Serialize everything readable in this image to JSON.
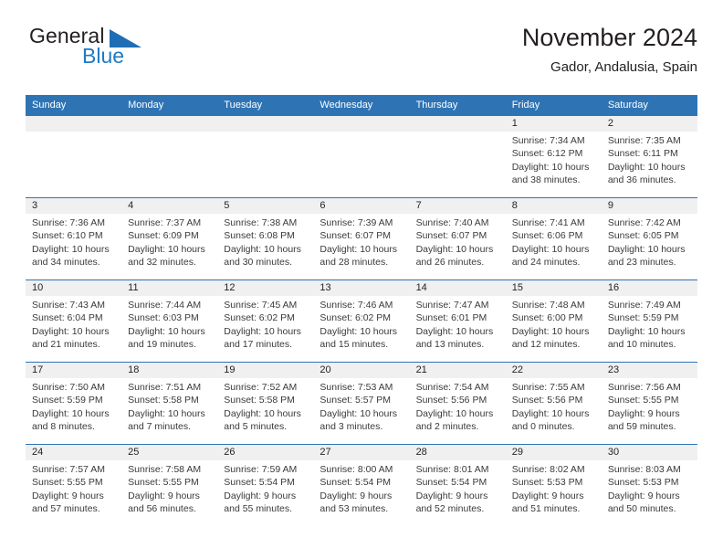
{
  "brand": {
    "name_top": "General",
    "name_bottom": "Blue",
    "triangle_color": "#1f6eb5",
    "blue_color": "#1f7ac4"
  },
  "header": {
    "title": "November 2024",
    "subtitle": "Gador, Andalusia, Spain"
  },
  "theme": {
    "header_blue": "#2e74b5",
    "day_band_gray": "#f0f0f0",
    "text_color": "#231f20"
  },
  "weekdays": [
    "Sunday",
    "Monday",
    "Tuesday",
    "Wednesday",
    "Thursday",
    "Friday",
    "Saturday"
  ],
  "weeks": [
    [
      {
        "day": "",
        "sunrise": "",
        "sunset": "",
        "daylight1": "",
        "daylight2": ""
      },
      {
        "day": "",
        "sunrise": "",
        "sunset": "",
        "daylight1": "",
        "daylight2": ""
      },
      {
        "day": "",
        "sunrise": "",
        "sunset": "",
        "daylight1": "",
        "daylight2": ""
      },
      {
        "day": "",
        "sunrise": "",
        "sunset": "",
        "daylight1": "",
        "daylight2": ""
      },
      {
        "day": "",
        "sunrise": "",
        "sunset": "",
        "daylight1": "",
        "daylight2": ""
      },
      {
        "day": "1",
        "sunrise": "Sunrise: 7:34 AM",
        "sunset": "Sunset: 6:12 PM",
        "daylight1": "Daylight: 10 hours",
        "daylight2": "and 38 minutes."
      },
      {
        "day": "2",
        "sunrise": "Sunrise: 7:35 AM",
        "sunset": "Sunset: 6:11 PM",
        "daylight1": "Daylight: 10 hours",
        "daylight2": "and 36 minutes."
      }
    ],
    [
      {
        "day": "3",
        "sunrise": "Sunrise: 7:36 AM",
        "sunset": "Sunset: 6:10 PM",
        "daylight1": "Daylight: 10 hours",
        "daylight2": "and 34 minutes."
      },
      {
        "day": "4",
        "sunrise": "Sunrise: 7:37 AM",
        "sunset": "Sunset: 6:09 PM",
        "daylight1": "Daylight: 10 hours",
        "daylight2": "and 32 minutes."
      },
      {
        "day": "5",
        "sunrise": "Sunrise: 7:38 AM",
        "sunset": "Sunset: 6:08 PM",
        "daylight1": "Daylight: 10 hours",
        "daylight2": "and 30 minutes."
      },
      {
        "day": "6",
        "sunrise": "Sunrise: 7:39 AM",
        "sunset": "Sunset: 6:07 PM",
        "daylight1": "Daylight: 10 hours",
        "daylight2": "and 28 minutes."
      },
      {
        "day": "7",
        "sunrise": "Sunrise: 7:40 AM",
        "sunset": "Sunset: 6:07 PM",
        "daylight1": "Daylight: 10 hours",
        "daylight2": "and 26 minutes."
      },
      {
        "day": "8",
        "sunrise": "Sunrise: 7:41 AM",
        "sunset": "Sunset: 6:06 PM",
        "daylight1": "Daylight: 10 hours",
        "daylight2": "and 24 minutes."
      },
      {
        "day": "9",
        "sunrise": "Sunrise: 7:42 AM",
        "sunset": "Sunset: 6:05 PM",
        "daylight1": "Daylight: 10 hours",
        "daylight2": "and 23 minutes."
      }
    ],
    [
      {
        "day": "10",
        "sunrise": "Sunrise: 7:43 AM",
        "sunset": "Sunset: 6:04 PM",
        "daylight1": "Daylight: 10 hours",
        "daylight2": "and 21 minutes."
      },
      {
        "day": "11",
        "sunrise": "Sunrise: 7:44 AM",
        "sunset": "Sunset: 6:03 PM",
        "daylight1": "Daylight: 10 hours",
        "daylight2": "and 19 minutes."
      },
      {
        "day": "12",
        "sunrise": "Sunrise: 7:45 AM",
        "sunset": "Sunset: 6:02 PM",
        "daylight1": "Daylight: 10 hours",
        "daylight2": "and 17 minutes."
      },
      {
        "day": "13",
        "sunrise": "Sunrise: 7:46 AM",
        "sunset": "Sunset: 6:02 PM",
        "daylight1": "Daylight: 10 hours",
        "daylight2": "and 15 minutes."
      },
      {
        "day": "14",
        "sunrise": "Sunrise: 7:47 AM",
        "sunset": "Sunset: 6:01 PM",
        "daylight1": "Daylight: 10 hours",
        "daylight2": "and 13 minutes."
      },
      {
        "day": "15",
        "sunrise": "Sunrise: 7:48 AM",
        "sunset": "Sunset: 6:00 PM",
        "daylight1": "Daylight: 10 hours",
        "daylight2": "and 12 minutes."
      },
      {
        "day": "16",
        "sunrise": "Sunrise: 7:49 AM",
        "sunset": "Sunset: 5:59 PM",
        "daylight1": "Daylight: 10 hours",
        "daylight2": "and 10 minutes."
      }
    ],
    [
      {
        "day": "17",
        "sunrise": "Sunrise: 7:50 AM",
        "sunset": "Sunset: 5:59 PM",
        "daylight1": "Daylight: 10 hours",
        "daylight2": "and 8 minutes."
      },
      {
        "day": "18",
        "sunrise": "Sunrise: 7:51 AM",
        "sunset": "Sunset: 5:58 PM",
        "daylight1": "Daylight: 10 hours",
        "daylight2": "and 7 minutes."
      },
      {
        "day": "19",
        "sunrise": "Sunrise: 7:52 AM",
        "sunset": "Sunset: 5:58 PM",
        "daylight1": "Daylight: 10 hours",
        "daylight2": "and 5 minutes."
      },
      {
        "day": "20",
        "sunrise": "Sunrise: 7:53 AM",
        "sunset": "Sunset: 5:57 PM",
        "daylight1": "Daylight: 10 hours",
        "daylight2": "and 3 minutes."
      },
      {
        "day": "21",
        "sunrise": "Sunrise: 7:54 AM",
        "sunset": "Sunset: 5:56 PM",
        "daylight1": "Daylight: 10 hours",
        "daylight2": "and 2 minutes."
      },
      {
        "day": "22",
        "sunrise": "Sunrise: 7:55 AM",
        "sunset": "Sunset: 5:56 PM",
        "daylight1": "Daylight: 10 hours",
        "daylight2": "and 0 minutes."
      },
      {
        "day": "23",
        "sunrise": "Sunrise: 7:56 AM",
        "sunset": "Sunset: 5:55 PM",
        "daylight1": "Daylight: 9 hours",
        "daylight2": "and 59 minutes."
      }
    ],
    [
      {
        "day": "24",
        "sunrise": "Sunrise: 7:57 AM",
        "sunset": "Sunset: 5:55 PM",
        "daylight1": "Daylight: 9 hours",
        "daylight2": "and 57 minutes."
      },
      {
        "day": "25",
        "sunrise": "Sunrise: 7:58 AM",
        "sunset": "Sunset: 5:55 PM",
        "daylight1": "Daylight: 9 hours",
        "daylight2": "and 56 minutes."
      },
      {
        "day": "26",
        "sunrise": "Sunrise: 7:59 AM",
        "sunset": "Sunset: 5:54 PM",
        "daylight1": "Daylight: 9 hours",
        "daylight2": "and 55 minutes."
      },
      {
        "day": "27",
        "sunrise": "Sunrise: 8:00 AM",
        "sunset": "Sunset: 5:54 PM",
        "daylight1": "Daylight: 9 hours",
        "daylight2": "and 53 minutes."
      },
      {
        "day": "28",
        "sunrise": "Sunrise: 8:01 AM",
        "sunset": "Sunset: 5:54 PM",
        "daylight1": "Daylight: 9 hours",
        "daylight2": "and 52 minutes."
      },
      {
        "day": "29",
        "sunrise": "Sunrise: 8:02 AM",
        "sunset": "Sunset: 5:53 PM",
        "daylight1": "Daylight: 9 hours",
        "daylight2": "and 51 minutes."
      },
      {
        "day": "30",
        "sunrise": "Sunrise: 8:03 AM",
        "sunset": "Sunset: 5:53 PM",
        "daylight1": "Daylight: 9 hours",
        "daylight2": "and 50 minutes."
      }
    ]
  ]
}
